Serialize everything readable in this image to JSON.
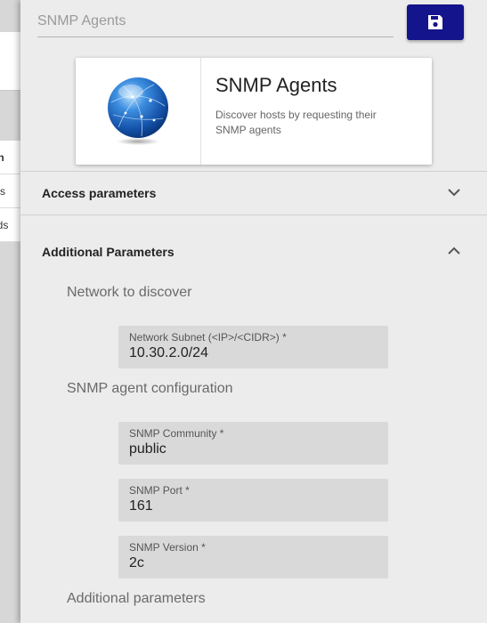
{
  "background": {
    "rows": [
      "on",
      "tes",
      "nds"
    ]
  },
  "header": {
    "title_value": "SNMP Agents",
    "save_icon": "floppy-disk-icon"
  },
  "card": {
    "icon": "globe-icon",
    "title": "SNMP Agents",
    "description": "Discover hosts by requesting their SNMP agents"
  },
  "sections": {
    "access": {
      "label": "Access parameters",
      "icon": "chevron-down-icon"
    },
    "additional": {
      "label": "Additional Parameters",
      "icon": "chevron-up-icon"
    }
  },
  "subheads": {
    "network": "Network to discover",
    "snmp": "SNMP agent configuration",
    "additional": "Additional parameters"
  },
  "fields": {
    "subnet": {
      "label": "Network Subnet (<IP>/<CIDR>) *",
      "value": "10.30.2.0/24"
    },
    "community": {
      "label": "SNMP Community *",
      "value": "public"
    },
    "port": {
      "label": "SNMP Port *",
      "value": "161"
    },
    "version": {
      "label": "SNMP Version *",
      "value": "2c"
    }
  },
  "colors": {
    "save_button": "#14148c",
    "drawer_bg": "#ececec",
    "field_bg": "#d9d9d9"
  }
}
